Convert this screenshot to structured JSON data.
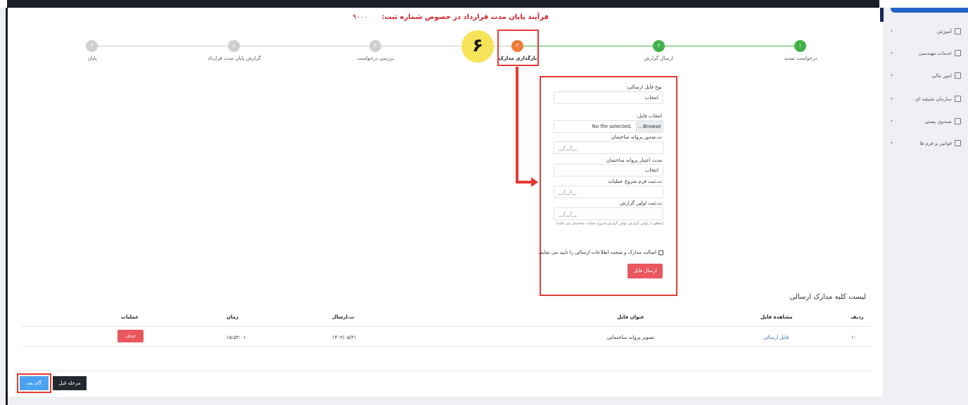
{
  "page": {
    "title": "فرآیند پایان مدت قرارداد در خصوص شماره ثبت:",
    "record_number": "۹۰۰۰",
    "highlight_number": "۶"
  },
  "steps": [
    {
      "number": "۱",
      "label": "درخواست تمدید",
      "state": "done"
    },
    {
      "number": "۲",
      "label": "ارسال گزارش",
      "state": "done"
    },
    {
      "number": "۳",
      "label": "بارگذاری مدارک",
      "state": "active"
    },
    {
      "number": "۴",
      "label": "بررسی درخواست",
      "state": "pending"
    },
    {
      "number": "۵",
      "label": "گزارش پایان مدت قرارداد",
      "state": "pending"
    },
    {
      "number": "۶",
      "label": "پایان",
      "state": "pending"
    }
  ],
  "form": {
    "file_type_label": "نوع فایل ارسالی:",
    "file_type_value": "انتخاب",
    "file_select_label": "انتخاب فایل:",
    "file_none": "No file selected.",
    "file_browse": "...Browse",
    "permit_issue_label": "ت.صدور پروانه ساختمان",
    "permit_issue_value": "__/__/__",
    "permit_validity_label": "مدت اعتبار پروانه ساختمان",
    "permit_validity_value": "انتخاب",
    "start_form_label": "ت.ثبت فرم شروع عملیات",
    "start_form_value": "__/__/__",
    "first_report_label": "ت.ثبت اولین گزارش",
    "first_report_value": "__/__/__",
    "note": "(منظور از اولین گزارش، اولین گزارش شروع عملیات ساختمان می باشد)",
    "confirm_text": "اصالت مدارک و صحت اطلاعات ارسالی را تایید می نمایم.",
    "submit_label": "ارسال فایل"
  },
  "list": {
    "title": "لیست کلیه مدارک ارسالی",
    "headers": {
      "row": "ردیف",
      "view": "مشاهده فایل",
      "file_title": "عنوان فایل",
      "send_date": "ت.ارسال",
      "time": "زمان",
      "ops": "عملیات"
    },
    "rows": [
      {
        "row": "۱-",
        "view": "فایل ارسالی",
        "file_title": "تصویر پروانه ساختمانی",
        "send_date": "۱۴۰۲/۰۵/۲۱",
        "time": "۱۵:۵۳:۰۱",
        "delete": "حذف"
      }
    ]
  },
  "nav": {
    "next": "گام بعد",
    "prev": "مرحله قبل"
  },
  "sidebar": {
    "items": [
      {
        "label": "آموزش",
        "icon": "education-icon"
      },
      {
        "label": "خدمات مهندسی",
        "icon": "engineer-icon"
      },
      {
        "label": "امور مالی",
        "icon": "finance-icon"
      },
      {
        "label": "سازمان شیشه ای",
        "icon": "organization-icon"
      },
      {
        "label": "صندوق پستی",
        "icon": "mailbox-icon"
      },
      {
        "label": "قوانین و فرم ها",
        "icon": "rules-icon"
      }
    ]
  },
  "colors": {
    "accent_red": "#e53935",
    "done_green": "#43b049",
    "active_orange": "#f07a3c",
    "primary_blue": "#4aa3f0"
  }
}
